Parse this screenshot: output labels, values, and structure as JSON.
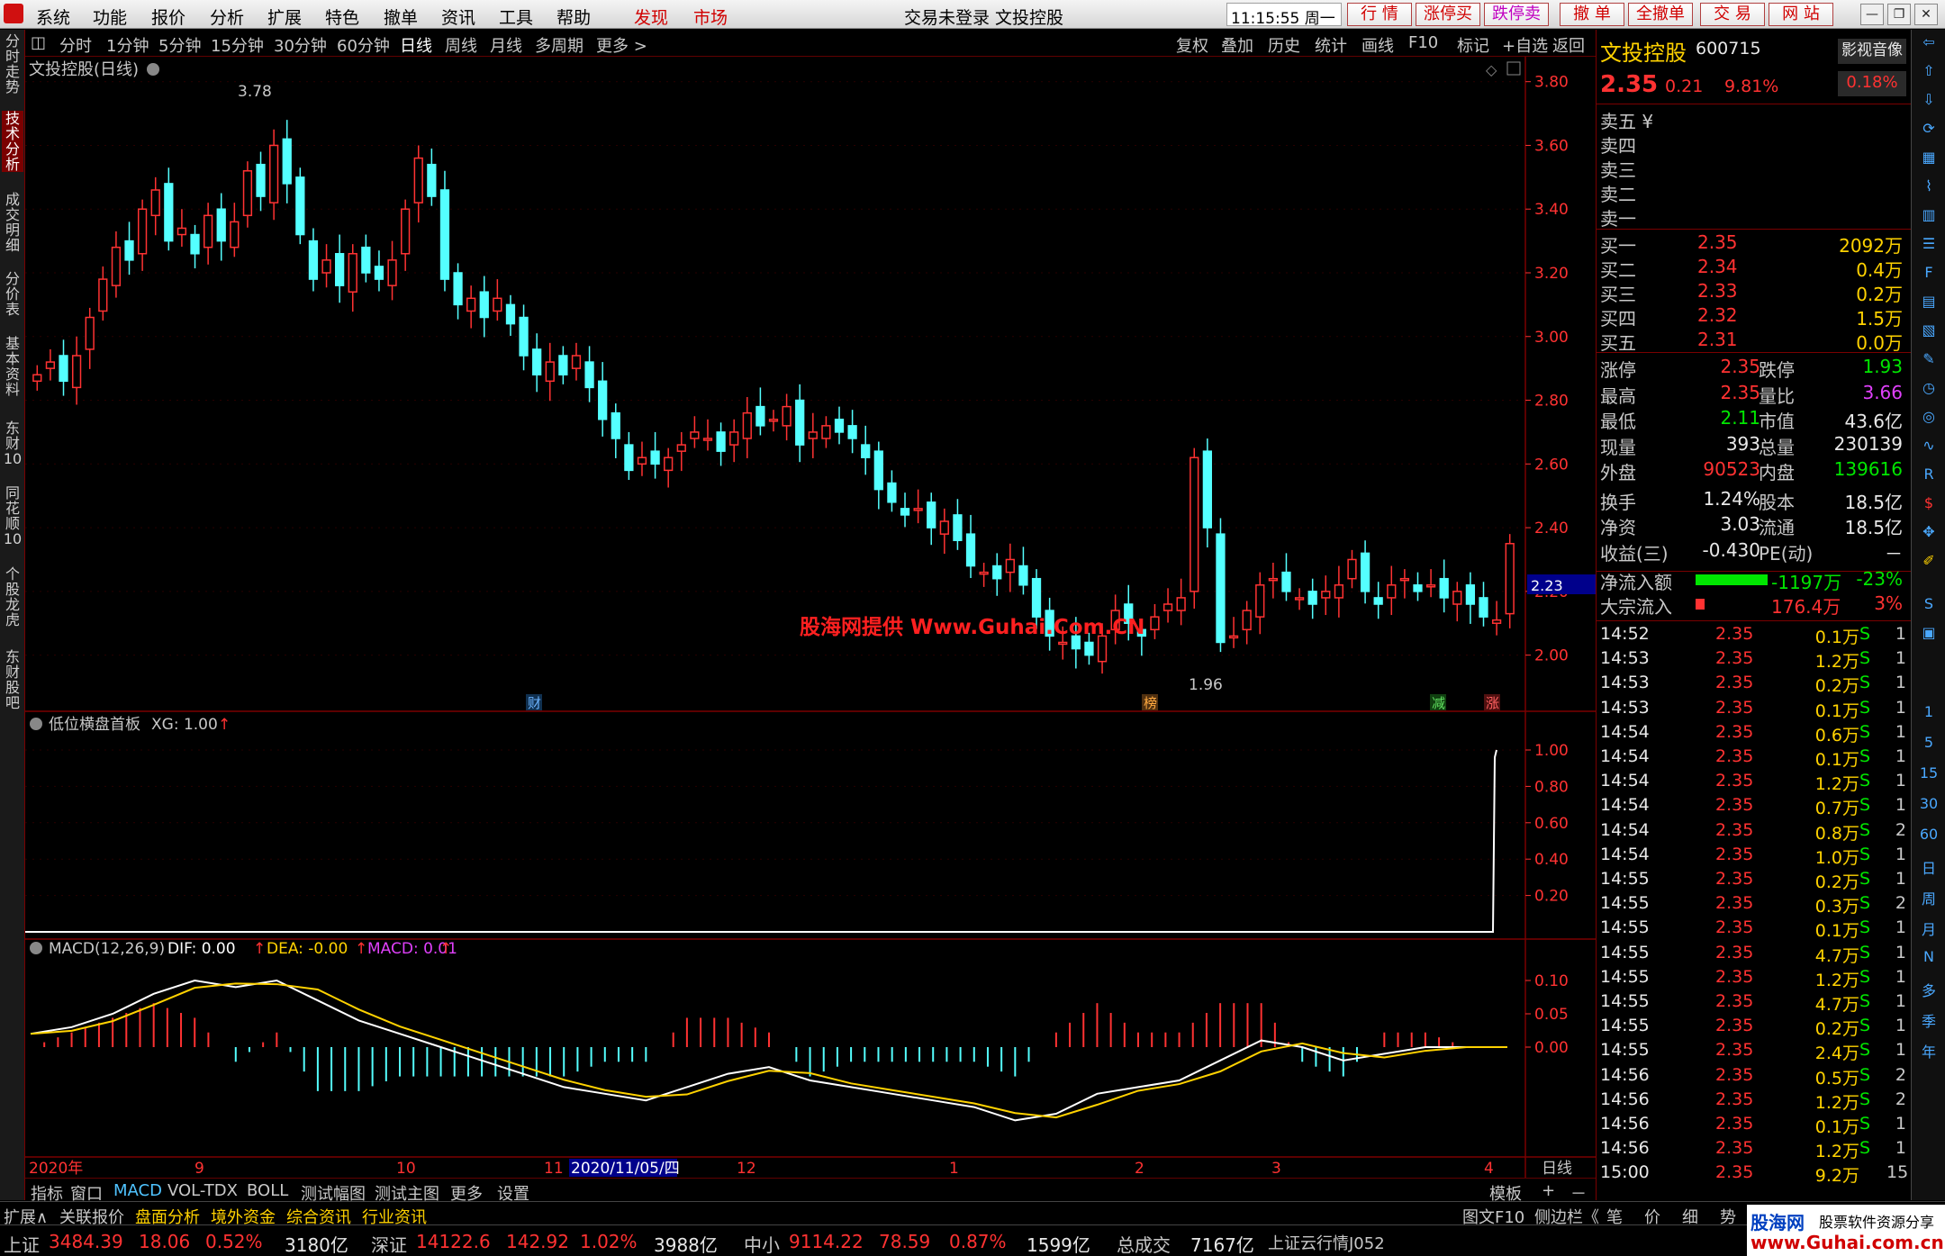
{
  "menubar": {
    "items": [
      "系统",
      "功能",
      "报价",
      "分析",
      "扩展",
      "特色",
      "撤单",
      "资讯",
      "工具",
      "帮助",
      "发现",
      "市场"
    ],
    "title": "交易未登录 文投控股",
    "clock": "11:15:55 周一",
    "trade_buttons": [
      "行 情",
      "涨停买",
      "跌停卖",
      "撤 单",
      "全撤单",
      "交 易",
      "网 站"
    ]
  },
  "left_tabs": [
    "分时走势",
    "技术分析",
    "成交明细",
    "分价表",
    "基本资料",
    "东财10",
    "同花顺10",
    "个股龙虎",
    "东财股吧"
  ],
  "period_bar": {
    "items": [
      "分时",
      "1分钟",
      "5分钟",
      "15分钟",
      "30分钟",
      "60分钟",
      "日线",
      "周线",
      "月线",
      "多周期",
      "更多 >"
    ],
    "selected": "日线",
    "tools": [
      "复权",
      "叠加",
      "历史",
      "统计",
      "画线",
      "F10",
      "标记",
      "+自选",
      "返回"
    ]
  },
  "main_chart": {
    "title": "文投控股(日线)",
    "high_label": "3.78",
    "low_label": "1.96",
    "price_tag": "2.23",
    "watermark": "股海网提供 Www.Guhai.Com.CN",
    "markers": [
      "财",
      "榜",
      "减",
      "涨"
    ],
    "y_ticks": [
      "3.80",
      "3.60",
      "3.40",
      "3.20",
      "3.00",
      "2.80",
      "2.60",
      "2.40",
      "2.20",
      "2.00"
    ]
  },
  "indicator1": {
    "title": "低位横盘首板",
    "xg_label": "XG: 1.00",
    "y_ticks": [
      "1.00",
      "0.80",
      "0.60",
      "0.40",
      "0.20"
    ]
  },
  "macd": {
    "title": "MACD(12,26,9)",
    "dif_label": "DIF: 0.00",
    "dea_label": "DEA: -0.00",
    "macd_label": "MACD: 0.01",
    "y_ticks": [
      "0.10",
      "0.05",
      "0.00"
    ]
  },
  "x_axis": {
    "labels": [
      "2020年",
      "9",
      "10",
      "11",
      "2020/11/05/四",
      "12",
      "1",
      "2",
      "3",
      "4"
    ],
    "period": "日线"
  },
  "chart_data": {
    "type": "candlestick",
    "y_range": [
      1.9,
      3.85
    ],
    "closes": [
      2.88,
      2.92,
      2.86,
      2.94,
      3.06,
      3.18,
      3.28,
      3.24,
      3.4,
      3.46,
      3.3,
      3.34,
      3.26,
      3.38,
      3.3,
      3.36,
      3.52,
      3.44,
      3.6,
      3.48,
      3.32,
      3.18,
      3.24,
      3.16,
      3.26,
      3.2,
      3.18,
      3.24,
      3.4,
      3.56,
      3.44,
      3.18,
      3.1,
      3.12,
      3.06,
      3.12,
      3.04,
      2.94,
      2.88,
      2.92,
      2.88,
      2.94,
      2.84,
      2.74,
      2.68,
      2.58,
      2.62,
      2.6,
      2.62,
      2.66,
      2.7,
      2.68,
      2.64,
      2.7,
      2.76,
      2.72,
      2.74,
      2.78,
      2.66,
      2.7,
      2.72,
      2.7,
      2.68,
      2.62,
      2.52,
      2.48,
      2.44,
      2.46,
      2.4,
      2.42,
      2.36,
      2.28,
      2.26,
      2.24,
      2.3,
      2.22,
      2.12,
      2.06,
      2.04,
      2.02,
      2.0,
      2.06,
      2.14,
      2.1,
      2.06,
      2.12,
      2.16,
      2.18,
      2.62,
      2.4,
      2.04,
      2.06,
      2.14,
      2.22,
      2.24,
      2.2,
      2.18,
      2.16,
      2.2,
      2.22,
      2.3,
      2.2,
      2.16,
      2.22,
      2.24,
      2.2,
      2.22,
      2.18,
      2.2,
      2.16,
      2.12,
      2.11,
      2.35
    ],
    "macd_dif": [
      0.02,
      0.03,
      0.05,
      0.08,
      0.1,
      0.09,
      0.1,
      0.07,
      0.04,
      0.02,
      0.0,
      -0.02,
      -0.04,
      -0.06,
      -0.07,
      -0.08,
      -0.06,
      -0.04,
      -0.03,
      -0.05,
      -0.06,
      -0.07,
      -0.08,
      -0.09,
      -0.11,
      -0.1,
      -0.07,
      -0.06,
      -0.05,
      -0.02,
      0.01,
      0.0,
      -0.02,
      -0.01,
      0.0,
      0.0,
      0.0
    ],
    "xg": [
      0,
      0,
      0,
      0,
      0,
      0,
      0,
      0,
      0,
      0,
      0,
      0,
      0,
      0,
      0,
      0,
      0,
      0,
      0,
      0,
      1
    ]
  },
  "quote": {
    "name": "文投控股",
    "code": "600715",
    "price": "2.35",
    "change": "0.21",
    "pct": "9.81%",
    "side_btn": "影视音像",
    "side_pct": "0.18%",
    "sells": [
      "卖五 ¥",
      "卖四",
      "卖三",
      "卖二",
      "卖一"
    ],
    "buys": [
      {
        "label": "买一",
        "price": "2.35",
        "vol": "2092万"
      },
      {
        "label": "买二",
        "price": "2.34",
        "vol": "0.4万"
      },
      {
        "label": "买三",
        "price": "2.33",
        "vol": "0.2万"
      },
      {
        "label": "买四",
        "price": "2.32",
        "vol": "1.5万"
      },
      {
        "label": "买五",
        "price": "2.31",
        "vol": "0.0万"
      }
    ],
    "stats": [
      {
        "l1": "涨停",
        "v1": "2.35",
        "c1": "red",
        "l2": "跌停",
        "v2": "1.93",
        "c2": "green"
      },
      {
        "l1": "最高",
        "v1": "2.35",
        "c1": "red",
        "l2": "量比",
        "v2": "3.66",
        "c2": "mag"
      },
      {
        "l1": "最低",
        "v1": "2.11",
        "c1": "green",
        "l2": "市值",
        "v2": "43.6亿",
        "c2": "white"
      },
      {
        "l1": "现量",
        "v1": "393",
        "c1": "white",
        "l2": "总量",
        "v2": "230139",
        "c2": "white"
      },
      {
        "l1": "外盘",
        "v1": "90523",
        "c1": "red",
        "l2": "内盘",
        "v2": "139616",
        "c2": "green"
      },
      {
        "l1": "换手",
        "v1": "1.24%",
        "c1": "white",
        "l2": "股本",
        "v2": "18.5亿",
        "c2": "white"
      },
      {
        "l1": "净资",
        "v1": "3.03",
        "c1": "white",
        "l2": "流通",
        "v2": "18.5亿",
        "c2": "white"
      },
      {
        "l1": "收益(三)",
        "v1": "-0.430",
        "c1": "white",
        "l2": "PE(动)",
        "v2": "－",
        "c2": "white"
      }
    ],
    "flow": [
      {
        "label": "净流入额",
        "value": "-1197万",
        "pct": "-23%"
      },
      {
        "label": "大宗流入",
        "value": "176.4万",
        "pct": "3%"
      }
    ]
  },
  "ticks": [
    {
      "t": "14:52",
      "p": "2.35",
      "q": "0.1万",
      "s": "S",
      "n": "1"
    },
    {
      "t": "14:53",
      "p": "2.35",
      "q": "1.2万",
      "s": "S",
      "n": "1"
    },
    {
      "t": "14:53",
      "p": "2.35",
      "q": "0.2万",
      "s": "S",
      "n": "1"
    },
    {
      "t": "14:53",
      "p": "2.35",
      "q": "0.1万",
      "s": "S",
      "n": "1"
    },
    {
      "t": "14:54",
      "p": "2.35",
      "q": "0.6万",
      "s": "S",
      "n": "1"
    },
    {
      "t": "14:54",
      "p": "2.35",
      "q": "0.1万",
      "s": "S",
      "n": "1"
    },
    {
      "t": "14:54",
      "p": "2.35",
      "q": "1.2万",
      "s": "S",
      "n": "1"
    },
    {
      "t": "14:54",
      "p": "2.35",
      "q": "0.7万",
      "s": "S",
      "n": "1"
    },
    {
      "t": "14:54",
      "p": "2.35",
      "q": "0.8万",
      "s": "S",
      "n": "2"
    },
    {
      "t": "14:54",
      "p": "2.35",
      "q": "1.0万",
      "s": "S",
      "n": "1"
    },
    {
      "t": "14:55",
      "p": "2.35",
      "q": "0.2万",
      "s": "S",
      "n": "1"
    },
    {
      "t": "14:55",
      "p": "2.35",
      "q": "0.3万",
      "s": "S",
      "n": "2"
    },
    {
      "t": "14:55",
      "p": "2.35",
      "q": "0.1万",
      "s": "S",
      "n": "1"
    },
    {
      "t": "14:55",
      "p": "2.35",
      "q": "4.7万",
      "s": "S",
      "n": "1"
    },
    {
      "t": "14:55",
      "p": "2.35",
      "q": "1.2万",
      "s": "S",
      "n": "1"
    },
    {
      "t": "14:55",
      "p": "2.35",
      "q": "4.7万",
      "s": "S",
      "n": "1"
    },
    {
      "t": "14:55",
      "p": "2.35",
      "q": "0.2万",
      "s": "S",
      "n": "1"
    },
    {
      "t": "14:55",
      "p": "2.35",
      "q": "2.4万",
      "s": "S",
      "n": "1"
    },
    {
      "t": "14:56",
      "p": "2.35",
      "q": "0.5万",
      "s": "S",
      "n": "2"
    },
    {
      "t": "14:56",
      "p": "2.35",
      "q": "1.2万",
      "s": "S",
      "n": "2"
    },
    {
      "t": "14:56",
      "p": "2.35",
      "q": "0.1万",
      "s": "S",
      "n": "1"
    },
    {
      "t": "14:56",
      "p": "2.35",
      "q": "1.2万",
      "s": "S",
      "n": "1"
    },
    {
      "t": "15:00",
      "p": "2.35",
      "q": "9.2万",
      "s": "",
      "n": "15"
    }
  ],
  "side_icons": [
    "1",
    "5",
    "15",
    "30",
    "60",
    "日",
    "周",
    "月",
    "N",
    "多",
    "季",
    "年"
  ],
  "bottom_tabs": [
    "指标",
    "窗口",
    "MACD",
    "VOL-TDX",
    "BOLL",
    "测试幅图",
    "测试主图",
    "更多",
    "设置"
  ],
  "bottom_right": [
    "模板",
    "+",
    "－"
  ],
  "bottom_tabs2": [
    "扩展∧",
    "关联报价",
    "盘面分析",
    "境外资金",
    "综合资讯",
    "行业资讯"
  ],
  "bottom_right2": [
    "图文F10",
    "侧边栏《",
    "笔",
    "价",
    "细",
    "势"
  ],
  "status": [
    {
      "name": "上证",
      "value": "3484.39",
      "chg": "18.06",
      "pct": "0.52%",
      "amt": "3180亿"
    },
    {
      "name": "深证",
      "value": "14122.6",
      "chg": "142.92",
      "pct": "1.02%",
      "amt": "3988亿"
    },
    {
      "name": "中小",
      "value": "9114.22",
      "chg": "78.59",
      "pct": "0.87%",
      "amt": "1599亿"
    }
  ],
  "status_total": {
    "label": "总成交",
    "value": "7167亿",
    "extra": "上证云行情J052"
  },
  "guhai": {
    "brand": "股海网",
    "sub": "股票软件资源分享",
    "url": "www.Guhai.com.cn"
  }
}
